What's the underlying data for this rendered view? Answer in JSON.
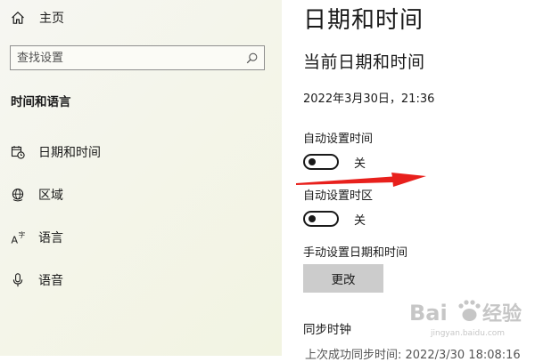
{
  "sidebar": {
    "home_label": "主页",
    "search_placeholder": "查找设置",
    "section_title": "时间和语言",
    "items": [
      {
        "label": "日期和时间",
        "icon": "calendar-clock-icon"
      },
      {
        "label": "区域",
        "icon": "globe-icon"
      },
      {
        "label": "语言",
        "icon": "language-icon"
      },
      {
        "label": "语音",
        "icon": "microphone-icon"
      }
    ]
  },
  "main": {
    "page_title": "日期和时间",
    "section_heading": "当前日期和时间",
    "current_datetime": "2022年3月30日，21:36",
    "auto_time": {
      "label": "自动设置时间",
      "state": "关"
    },
    "auto_timezone": {
      "label": "自动设置时区",
      "state": "关"
    },
    "manual": {
      "label": "手动设置日期和时间",
      "button": "更改"
    },
    "sync": {
      "title": "同步时钟",
      "last_sync": "上次成功同步时间: 2022/3/30 18:08:16"
    }
  },
  "watermark": {
    "text": "Baidu经验",
    "domain": "jingyan.baidu.com"
  },
  "colors": {
    "annotation_arrow": "#e8201c",
    "button_bg": "#cccccc",
    "sidebar_bg": "#f4f5ea"
  }
}
